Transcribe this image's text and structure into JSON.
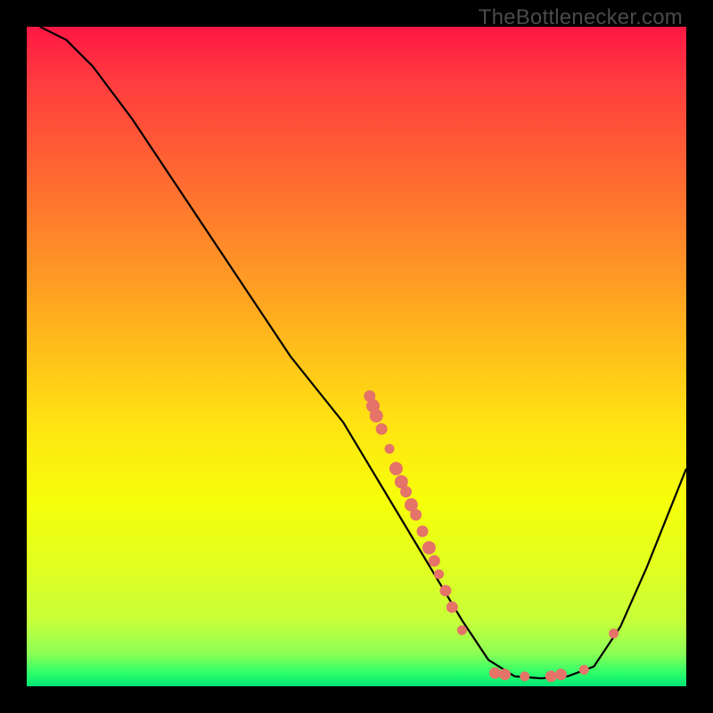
{
  "watermark": "TheBottlenecker.com",
  "colors": {
    "dot": "#e57368",
    "curve": "#000000",
    "gradient_top": "#ff1744",
    "gradient_bottom": "#00e676"
  },
  "chart_data": {
    "type": "line",
    "title": "",
    "xlabel": "",
    "ylabel": "",
    "xlim": [
      0,
      100
    ],
    "ylim": [
      0,
      100
    ],
    "grid": false,
    "legend": false,
    "curve_points": [
      {
        "x": 2,
        "y": 100
      },
      {
        "x": 6,
        "y": 98
      },
      {
        "x": 10,
        "y": 94
      },
      {
        "x": 16,
        "y": 86
      },
      {
        "x": 24,
        "y": 74
      },
      {
        "x": 32,
        "y": 62
      },
      {
        "x": 40,
        "y": 50
      },
      {
        "x": 48,
        "y": 40
      },
      {
        "x": 54,
        "y": 30
      },
      {
        "x": 60,
        "y": 20
      },
      {
        "x": 66,
        "y": 10
      },
      {
        "x": 70,
        "y": 4
      },
      {
        "x": 74,
        "y": 1.5
      },
      {
        "x": 78,
        "y": 1.2
      },
      {
        "x": 82,
        "y": 1.5
      },
      {
        "x": 86,
        "y": 3
      },
      {
        "x": 90,
        "y": 9
      },
      {
        "x": 94,
        "y": 18
      },
      {
        "x": 98,
        "y": 28
      },
      {
        "x": 100,
        "y": 33
      }
    ],
    "scatter_points": [
      {
        "x": 52,
        "y": 44,
        "r": 6
      },
      {
        "x": 52.5,
        "y": 42.5,
        "r": 7
      },
      {
        "x": 53,
        "y": 41,
        "r": 7
      },
      {
        "x": 53.8,
        "y": 39,
        "r": 6
      },
      {
        "x": 55,
        "y": 36,
        "r": 5
      },
      {
        "x": 56,
        "y": 33,
        "r": 7
      },
      {
        "x": 56.8,
        "y": 31,
        "r": 7
      },
      {
        "x": 57.5,
        "y": 29.5,
        "r": 6
      },
      {
        "x": 58.3,
        "y": 27.5,
        "r": 7
      },
      {
        "x": 59,
        "y": 26,
        "r": 6
      },
      {
        "x": 60,
        "y": 23.5,
        "r": 6
      },
      {
        "x": 61,
        "y": 21,
        "r": 7
      },
      {
        "x": 61.8,
        "y": 19,
        "r": 6
      },
      {
        "x": 62.5,
        "y": 17,
        "r": 5
      },
      {
        "x": 63.5,
        "y": 14.5,
        "r": 6
      },
      {
        "x": 64.5,
        "y": 12,
        "r": 6
      },
      {
        "x": 66,
        "y": 8.5,
        "r": 5
      },
      {
        "x": 71,
        "y": 2,
        "r": 6
      },
      {
        "x": 72.5,
        "y": 1.8,
        "r": 6
      },
      {
        "x": 75.5,
        "y": 1.5,
        "r": 5
      },
      {
        "x": 79.5,
        "y": 1.5,
        "r": 6
      },
      {
        "x": 81,
        "y": 1.8,
        "r": 6
      },
      {
        "x": 84.5,
        "y": 2.5,
        "r": 5
      },
      {
        "x": 89,
        "y": 8,
        "r": 5
      }
    ]
  }
}
